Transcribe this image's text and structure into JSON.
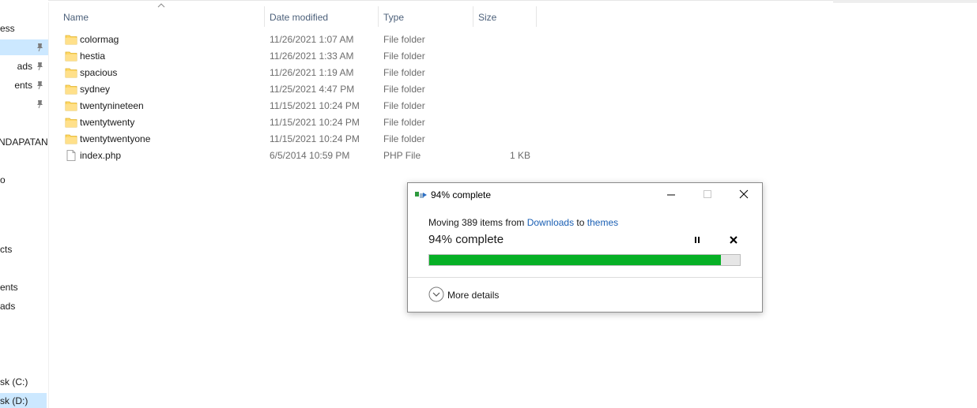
{
  "nav": {
    "items": [
      {
        "label": "ess",
        "pinned": false,
        "selected": false
      },
      {
        "label": "",
        "pinned": true,
        "selected": true
      },
      {
        "label": "ads",
        "pinned": true,
        "selected": false
      },
      {
        "label": "ents",
        "pinned": true,
        "selected": false
      },
      {
        "label": "",
        "pinned": true,
        "selected": false
      },
      {
        "label": "NDAPATAN",
        "pinned": false,
        "selected": false
      },
      {
        "label": "o",
        "pinned": false,
        "selected": false
      },
      {
        "label": "cts",
        "pinned": false,
        "selected": false
      },
      {
        "label": "ents",
        "pinned": false,
        "selected": false
      },
      {
        "label": "ads",
        "pinned": false,
        "selected": false
      },
      {
        "label": "sk (C:)",
        "pinned": false,
        "selected": false
      },
      {
        "label": "sk (D:)",
        "pinned": false,
        "selected": true
      }
    ]
  },
  "columns": {
    "name": "Name",
    "date": "Date modified",
    "type": "Type",
    "size": "Size"
  },
  "files": [
    {
      "name": "colormag",
      "date": "11/26/2021 1:07 AM",
      "type": "File folder",
      "size": "",
      "icon": "folder-icon"
    },
    {
      "name": "hestia",
      "date": "11/26/2021 1:33 AM",
      "type": "File folder",
      "size": "",
      "icon": "folder-icon"
    },
    {
      "name": "spacious",
      "date": "11/26/2021 1:19 AM",
      "type": "File folder",
      "size": "",
      "icon": "folder-icon"
    },
    {
      "name": "sydney",
      "date": "11/25/2021 4:47 PM",
      "type": "File folder",
      "size": "",
      "icon": "folder-icon"
    },
    {
      "name": "twentynineteen",
      "date": "11/15/2021 10:24 PM",
      "type": "File folder",
      "size": "",
      "icon": "folder-icon"
    },
    {
      "name": "twentytwenty",
      "date": "11/15/2021 10:24 PM",
      "type": "File folder",
      "size": "",
      "icon": "folder-icon"
    },
    {
      "name": "twentytwentyone",
      "date": "11/15/2021 10:24 PM",
      "type": "File folder",
      "size": "",
      "icon": "folder-icon"
    },
    {
      "name": "index.php",
      "date": "6/5/2014 10:59 PM",
      "type": "PHP File",
      "size": "1 KB",
      "icon": "file-icon"
    }
  ],
  "dialog": {
    "title": "94% complete",
    "moving_prefix": "Moving 389 items from ",
    "source": "Downloads",
    "moving_mid": " to ",
    "destination": "themes",
    "status": "94% complete",
    "progress_percent": 94,
    "more_details": "More details"
  },
  "colors": {
    "progress_fill": "#06b025",
    "link": "#1a5fb4",
    "selection": "#cce8ff"
  }
}
